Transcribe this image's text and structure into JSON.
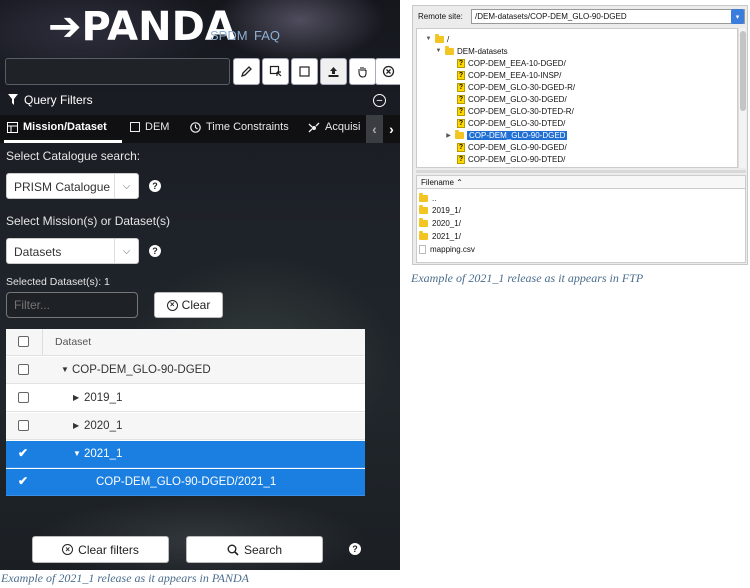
{
  "panda": {
    "logo": "➔PANDA",
    "nav": [
      "SPDM",
      "FAQ"
    ],
    "toolbar": {
      "icons": [
        "pencil-icon",
        "select-area-icon",
        "square-icon",
        "upload-icon",
        "hand-icon",
        "close-circle-icon"
      ]
    },
    "query_filters": {
      "title": "Query Filters"
    },
    "tabs": [
      {
        "label": "Mission/Dataset",
        "icon": "table-icon"
      },
      {
        "label": "DEM",
        "icon": "square-icon"
      },
      {
        "label": "Time Constraints",
        "icon": "clock-icon"
      },
      {
        "label": "Acquisi",
        "icon": "satellite-icon"
      }
    ],
    "catalogue": {
      "label": "Select Catalogue search:",
      "value": "PRISM Catalogue"
    },
    "mission": {
      "label": "Select Mission(s) or Dataset(s)",
      "value": "Datasets"
    },
    "selected_count": "Selected Dataset(s): 1",
    "filter": {
      "placeholder": "Filter..."
    },
    "clear_label": "Clear",
    "table": {
      "header": "Dataset",
      "rows": [
        {
          "label": "COP-DEM_GLO-90-DGED",
          "checked": false,
          "expanded": true
        },
        {
          "label": "2019_1",
          "checked": false,
          "expanded": false
        },
        {
          "label": "2020_1",
          "checked": false,
          "expanded": false
        },
        {
          "label": "2021_1",
          "checked": true,
          "expanded": true
        },
        {
          "label": "COP-DEM_GLO-90-DGED/2021_1",
          "checked": true
        }
      ]
    },
    "buttons": {
      "clear_filters": "Clear filters",
      "search": "Search"
    },
    "caption": "Example of 2021_1 release as it appears in PANDA"
  },
  "ftp": {
    "remote_site_label": "Remote site:",
    "remote_site_value": "/DEM-datasets/COP-DEM_GLO-90-DGED",
    "tree": [
      {
        "label": "/",
        "type": "folder"
      },
      {
        "label": "DEM-datasets",
        "type": "folder"
      },
      {
        "label": "COP-DEM_EEA-10-DGED/",
        "type": "unknown"
      },
      {
        "label": "COP-DEM_EEA-10-INSP/",
        "type": "unknown"
      },
      {
        "label": "COP-DEM_GLO-30-DGED-R/",
        "type": "unknown"
      },
      {
        "label": "COP-DEM_GLO-30-DGED/",
        "type": "unknown"
      },
      {
        "label": "COP-DEM_GLO-30-DTED-R/",
        "type": "unknown"
      },
      {
        "label": "COP-DEM_GLO-30-DTED/",
        "type": "unknown"
      },
      {
        "label": "COP-DEM_GLO-90-DGED",
        "type": "folder"
      },
      {
        "label": "COP-DEM_GLO-90-DGED/",
        "type": "unknown"
      },
      {
        "label": "COP-DEM_GLO-90-DTED/",
        "type": "unknown"
      }
    ],
    "files_header": "Filename",
    "files": [
      {
        "label": "..",
        "type": "folder"
      },
      {
        "label": "2019_1/",
        "type": "folder"
      },
      {
        "label": "2020_1/",
        "type": "folder"
      },
      {
        "label": "2021_1/",
        "type": "folder"
      },
      {
        "label": "mapping.csv",
        "type": "file"
      }
    ],
    "caption": "Example of 2021_1 release as it appears in FTP"
  },
  "colors": {
    "selection_blue": "#1a7fe0",
    "ftp_highlight": "#1f6fd4",
    "caption": "#4a6c8c",
    "folder": "#f2c523"
  }
}
